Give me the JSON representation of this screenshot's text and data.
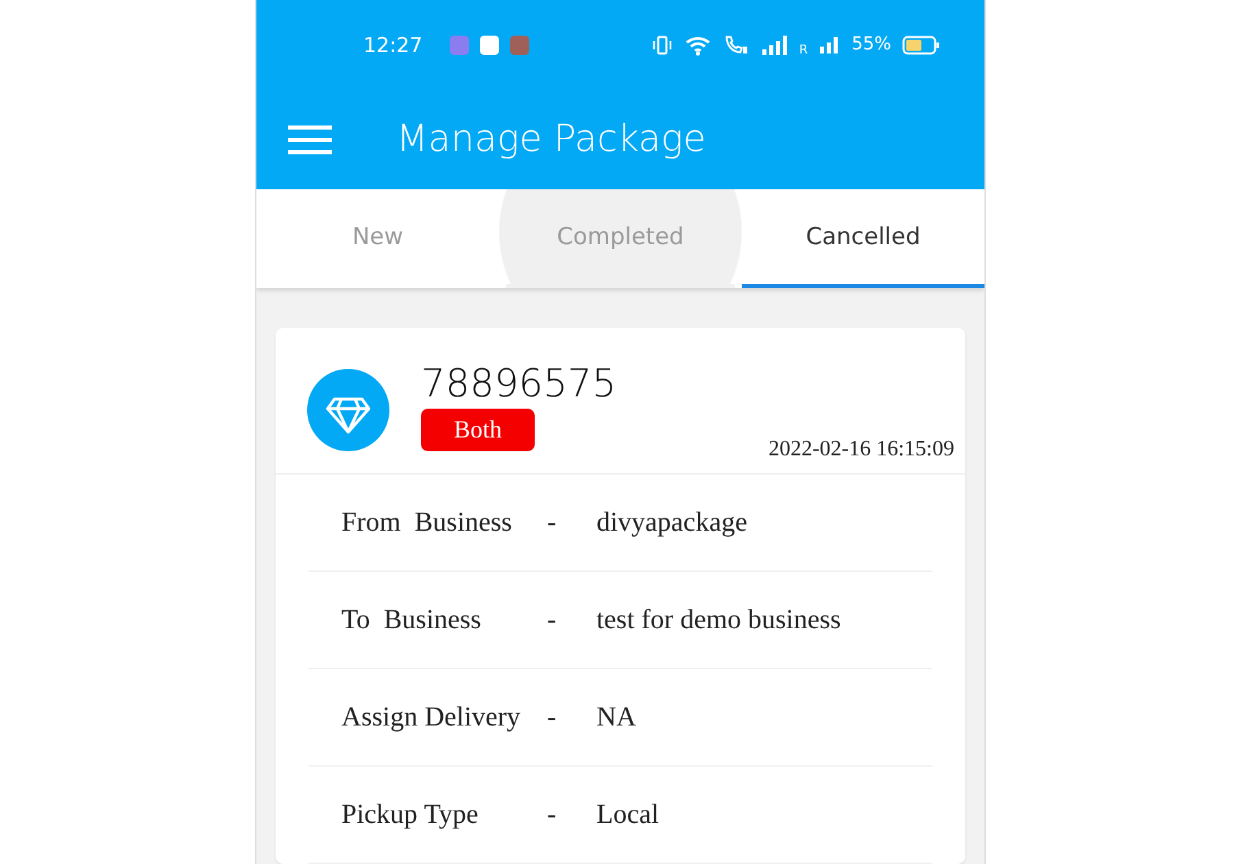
{
  "status_bar": {
    "time": "12:27",
    "roaming": "R",
    "battery": "55%"
  },
  "app_bar": {
    "title": "Manage Package"
  },
  "tabs": [
    {
      "label": "New",
      "selected": false,
      "pressed": false
    },
    {
      "label": "Completed",
      "selected": false,
      "pressed": true
    },
    {
      "label": "Cancelled",
      "selected": true,
      "pressed": false
    }
  ],
  "package": {
    "number": "78896575",
    "badge": "Both",
    "date": "2022-02-16 16:15:09",
    "details": [
      {
        "label": "From  Business",
        "separator": "-",
        "value": "divyapackage"
      },
      {
        "label": "To  Business",
        "separator": "-",
        "value": "test for demo business"
      },
      {
        "label": "Assign Delivery",
        "separator": "-",
        "value": "NA"
      },
      {
        "label": "Pickup Type",
        "separator": "-",
        "value": "Local"
      }
    ]
  }
}
